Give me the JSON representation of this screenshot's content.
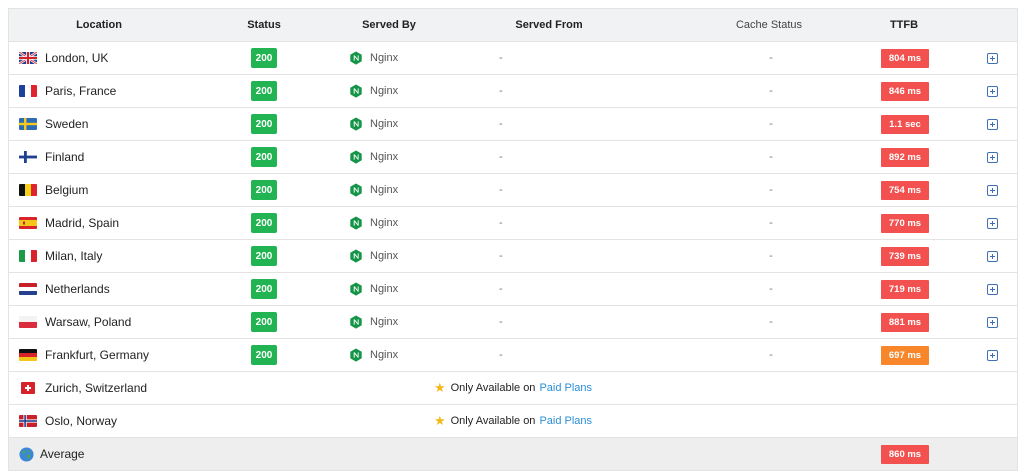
{
  "header": {
    "location": "Location",
    "status": "Status",
    "served_by": "Served By",
    "served_from": "Served From",
    "cache_status": "Cache Status",
    "ttfb": "TTFB"
  },
  "rows": [
    {
      "location": "London, UK",
      "flag": "uk-flag-icon",
      "status": "200",
      "served_by": "Nginx",
      "served_from": "-",
      "cache_status": "-",
      "ttfb": "804 ms",
      "ttfb_color": "#f2514f"
    },
    {
      "location": "Paris, France",
      "flag": "france-flag-icon",
      "status": "200",
      "served_by": "Nginx",
      "served_from": "-",
      "cache_status": "-",
      "ttfb": "846 ms",
      "ttfb_color": "#f2514f"
    },
    {
      "location": "Sweden",
      "flag": "sweden-flag-icon",
      "status": "200",
      "served_by": "Nginx",
      "served_from": "-",
      "cache_status": "-",
      "ttfb": "1.1 sec",
      "ttfb_color": "#f2514f"
    },
    {
      "location": "Finland",
      "flag": "finland-flag-icon",
      "status": "200",
      "served_by": "Nginx",
      "served_from": "-",
      "cache_status": "-",
      "ttfb": "892 ms",
      "ttfb_color": "#f2514f"
    },
    {
      "location": "Belgium",
      "flag": "belgium-flag-icon",
      "status": "200",
      "served_by": "Nginx",
      "served_from": "-",
      "cache_status": "-",
      "ttfb": "754 ms",
      "ttfb_color": "#f2514f"
    },
    {
      "location": "Madrid, Spain",
      "flag": "spain-flag-icon",
      "status": "200",
      "served_by": "Nginx",
      "served_from": "-",
      "cache_status": "-",
      "ttfb": "770 ms",
      "ttfb_color": "#f2514f"
    },
    {
      "location": "Milan, Italy",
      "flag": "italy-flag-icon",
      "status": "200",
      "served_by": "Nginx",
      "served_from": "-",
      "cache_status": "-",
      "ttfb": "739 ms",
      "ttfb_color": "#f2514f"
    },
    {
      "location": "Netherlands",
      "flag": "netherlands-flag-icon",
      "status": "200",
      "served_by": "Nginx",
      "served_from": "-",
      "cache_status": "-",
      "ttfb": "719 ms",
      "ttfb_color": "#f2514f"
    },
    {
      "location": "Warsaw, Poland",
      "flag": "poland-flag-icon",
      "status": "200",
      "served_by": "Nginx",
      "served_from": "-",
      "cache_status": "-",
      "ttfb": "881 ms",
      "ttfb_color": "#f2514f"
    },
    {
      "location": "Frankfurt, Germany",
      "flag": "germany-flag-icon",
      "status": "200",
      "served_by": "Nginx",
      "served_from": "-",
      "cache_status": "-",
      "ttfb": "697 ms",
      "ttfb_color": "#f7872a"
    }
  ],
  "locked_rows": [
    {
      "location": "Zurich, Switzerland",
      "flag": "switzerland-flag-icon"
    },
    {
      "location": "Oslo, Norway",
      "flag": "norway-flag-icon"
    }
  ],
  "paid_notice": {
    "text": "Only Available on",
    "link": "Paid Plans",
    "icon": "star-icon"
  },
  "average": {
    "label": "Average",
    "icon": "globe-icon",
    "ttfb": "860 ms",
    "ttfb_color": "#f2514f"
  },
  "colors": {
    "status_green": "#22b452",
    "ttfb_red": "#f2514f",
    "ttfb_orange": "#f7872a",
    "link_blue": "#2b8fd6"
  }
}
